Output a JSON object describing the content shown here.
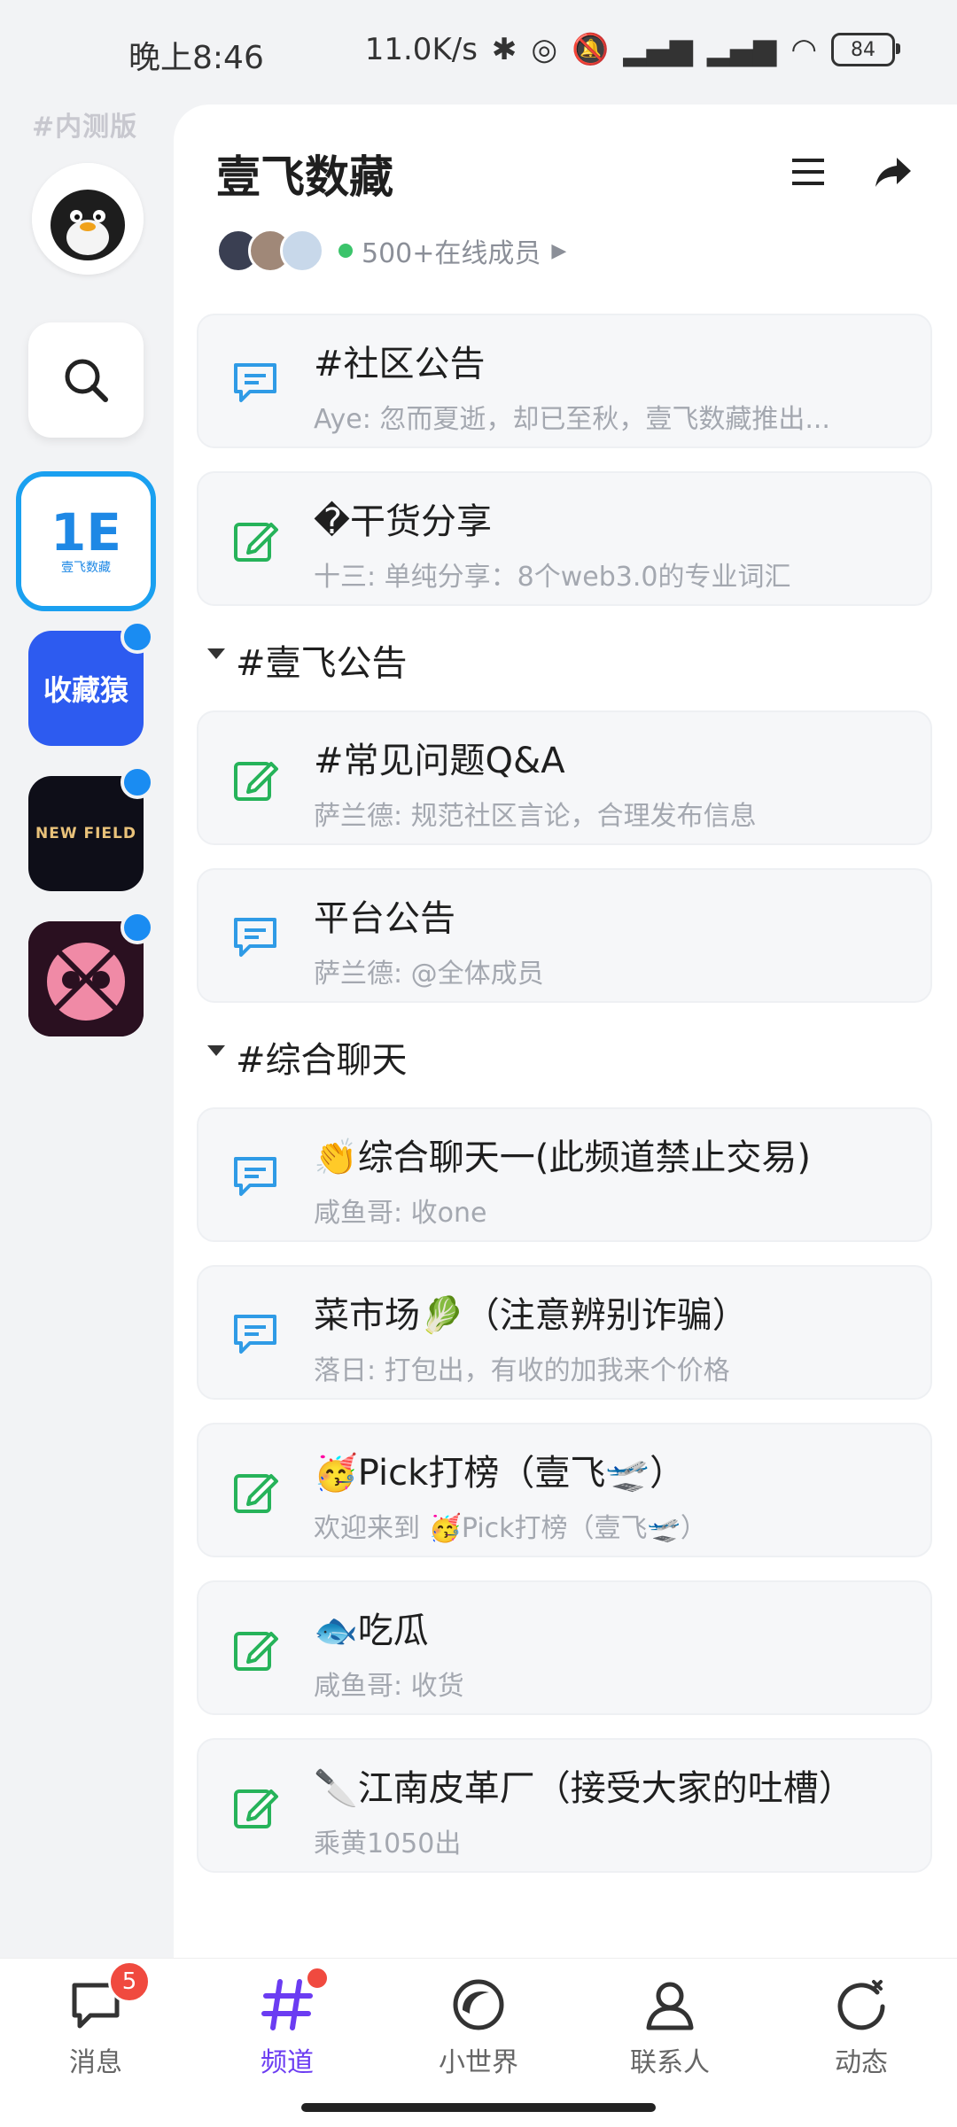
{
  "status_bar": {
    "time": "晚上8:46",
    "speed": "11.0K/s",
    "battery": "84"
  },
  "rail": {
    "beta_label": "#内测版",
    "servers": [
      {
        "name": "壹飞数藏",
        "selected": true,
        "tile_text": "壹飞数藏"
      },
      {
        "name": "收藏猿",
        "tile_text": "收藏猿",
        "unread": true
      },
      {
        "name": "NEW FIELD",
        "tile_text": "NEW FIELD",
        "unread": true
      },
      {
        "name": "community-4",
        "unread": true
      }
    ]
  },
  "header": {
    "title": "壹飞数藏",
    "online_text": "500+在线成员"
  },
  "channels": [
    {
      "type": "chat",
      "name": "#社区公告",
      "preview": "Aye: 忽而夏逝，却已至秋，壹飞数藏推出..."
    },
    {
      "type": "post",
      "name": "�干货分享",
      "preview": "十三: 单纯分享：8个web3.0的专业词汇"
    }
  ],
  "sections": [
    {
      "label": "#壹飞公告",
      "channels": [
        {
          "type": "post",
          "name": "#常见问题Q&A",
          "preview": "萨兰德: 规范社区言论，合理发布信息"
        },
        {
          "type": "chat",
          "name": "平台公告",
          "preview": "萨兰德: @全体成员"
        }
      ]
    },
    {
      "label": "#综合聊天",
      "channels": [
        {
          "type": "chat",
          "name": "👏综合聊天一(此频道禁止交易)",
          "preview": "咸鱼哥: 收one"
        },
        {
          "type": "chat",
          "name": "菜市场🥬（注意辨别诈骗）",
          "preview": "落日: 打包出，有收的加我来个价格"
        },
        {
          "type": "post",
          "name": "🥳Pick打榜（壹飞🛫）",
          "preview": "欢迎来到 🥳Pick打榜（壹飞🛫）"
        },
        {
          "type": "post",
          "name": "🐟吃瓜",
          "preview": "咸鱼哥: 收货"
        },
        {
          "type": "post",
          "name": "🔪江南皮革厂（接受大家的吐槽）",
          "preview": "乘黄1050出"
        }
      ]
    }
  ],
  "bottom_nav": [
    {
      "label": "消息",
      "badge": "5",
      "icon": "message-icon"
    },
    {
      "label": "频道",
      "active": true,
      "icon": "channel-hash-icon"
    },
    {
      "label": "小世界",
      "icon": "world-icon"
    },
    {
      "label": "联系人",
      "icon": "contact-icon"
    },
    {
      "label": "动态",
      "icon": "activity-icon"
    }
  ],
  "colors": {
    "accent": "#6b3cf2",
    "chat_icon": "#2f9be6",
    "post_icon": "#26b35a",
    "badge": "#f04a3f",
    "unread_dot": "#1a8cf2"
  }
}
